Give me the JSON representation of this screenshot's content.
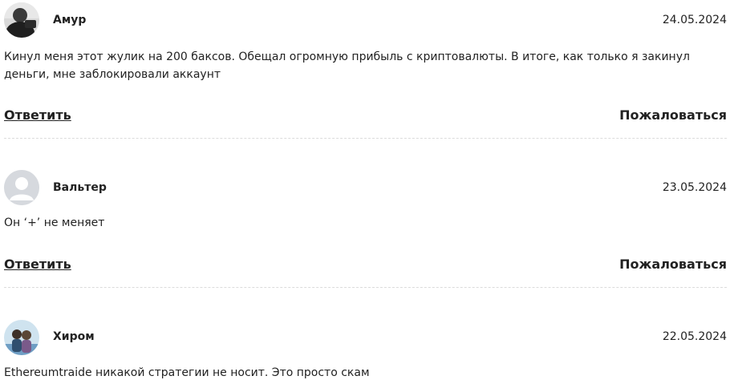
{
  "comments": [
    {
      "author": "Амур",
      "date": "24.05.2024",
      "text": "Кинул меня этот жулик на 200 баксов. Обещал огромную прибыль с криптовалюты. В итоге, как только я закинул деньги, мне заблокировали аккаунт",
      "reply_label": "Ответить",
      "report_label": "Пожаловаться",
      "avatar": "user-photo-icon"
    },
    {
      "author": "Вальтер",
      "date": "23.05.2024",
      "text": "Он ‘+’ не меняет",
      "reply_label": "Ответить",
      "report_label": "Пожаловаться",
      "avatar": "default-user-icon"
    },
    {
      "author": "Хиром",
      "date": "22.05.2024",
      "text": "Ethereumtraide никакой стратегии не носит. Это просто скам",
      "avatar": "user-photo-icon"
    }
  ],
  "colors": {
    "text": "#222222",
    "divider": "#dcdcdc",
    "default_avatar_bg": "#d6d9de",
    "default_avatar_fg": "#ffffff"
  }
}
